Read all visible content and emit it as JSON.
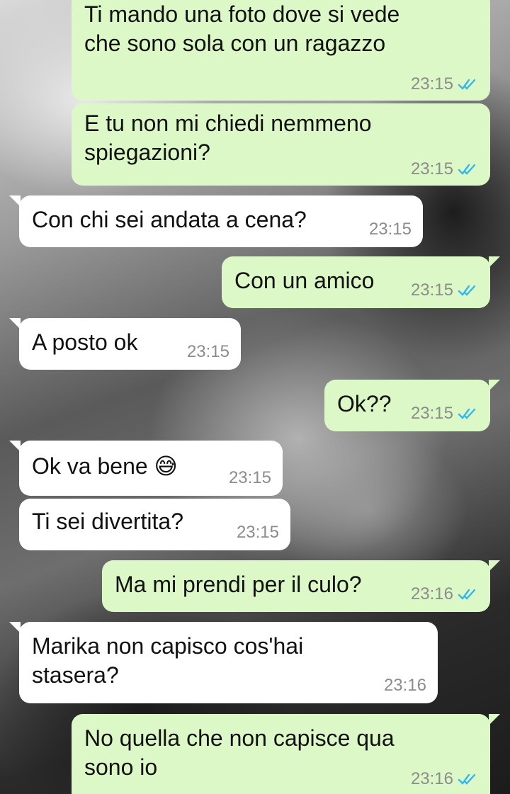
{
  "messages": [
    {
      "dir": "out",
      "text": "Ti mando una foto dove si vede\nche sono sola con un ragazzo",
      "time": "23:15",
      "status": "read"
    },
    {
      "dir": "out",
      "text": "E tu non mi chiedi nemmeno\nspiegazioni?",
      "time": "23:15",
      "status": "read"
    },
    {
      "dir": "in",
      "text": "Con chi sei andata a cena?",
      "time": "23:15"
    },
    {
      "dir": "out",
      "text": "Con un amico",
      "time": "23:15",
      "status": "read"
    },
    {
      "dir": "in",
      "text": "A posto ok",
      "time": "23:15"
    },
    {
      "dir": "out",
      "text": "Ok??",
      "time": "23:15",
      "status": "read"
    },
    {
      "dir": "in",
      "text": "Ok va bene 😅",
      "time": "23:15"
    },
    {
      "dir": "in",
      "text": "Ti sei divertita?",
      "time": "23:15"
    },
    {
      "dir": "out",
      "text": "Ma mi prendi per il culo?",
      "time": "23:16",
      "status": "read"
    },
    {
      "dir": "in",
      "text": "Marika non capisco cos'hai\nstasera?",
      "time": "23:16"
    },
    {
      "dir": "out",
      "text": "No quella che non capisce qua\nsono io",
      "time": "23:16",
      "status": "read"
    }
  ],
  "colors": {
    "outgoing_bubble": "#dcf8c6",
    "incoming_bubble": "#ffffff",
    "timestamp": "#8c8c8c",
    "read_ticks": "#34b7f1"
  },
  "icons": {
    "read_receipt": "double-check-icon"
  }
}
